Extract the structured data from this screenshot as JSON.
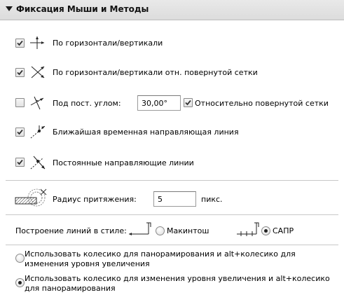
{
  "header": {
    "title": "Фиксация Мыши и Методы"
  },
  "snaps": [
    {
      "label": "По горизонтали/вертикали",
      "checked": true,
      "icon": "cross-arrows-icon"
    },
    {
      "label": "По горизонтали/вертикали отн. повернутой сетки",
      "checked": true,
      "icon": "diagonal-cross-arrows-icon"
    },
    {
      "label": "Под пост. углом:",
      "checked": false,
      "icon": "angle-arrows-icon"
    },
    {
      "label": "Ближайшая временная направляющая линия",
      "checked": true,
      "icon": "temp-guide-line-icon"
    },
    {
      "label": "Постоянные направляющие линии",
      "checked": true,
      "icon": "permanent-guide-lines-icon"
    }
  ],
  "angle": {
    "value": "30,00°",
    "rotated_grid_label": "Относительно повернутой сетки",
    "rotated_grid_checked": true
  },
  "radius": {
    "label": "Радиус притяжения:",
    "value": "5",
    "unit": "пикс.",
    "icon": "snap-radius-icon"
  },
  "line_style": {
    "label": "Построение линий в стиле:",
    "options": [
      {
        "label": "Макинтош",
        "selected": false,
        "icon": "mac-style-icon"
      },
      {
        "label": "САПР",
        "selected": true,
        "icon": "cad-style-icon"
      }
    ]
  },
  "wheel": [
    {
      "label": "Использовать колесико для панорамирования и alt+колесико для изменения уровня увеличения",
      "selected": false
    },
    {
      "label": "Использовать колесико для изменения уровня увеличения и alt+колесико для панорамирования",
      "selected": true
    }
  ]
}
